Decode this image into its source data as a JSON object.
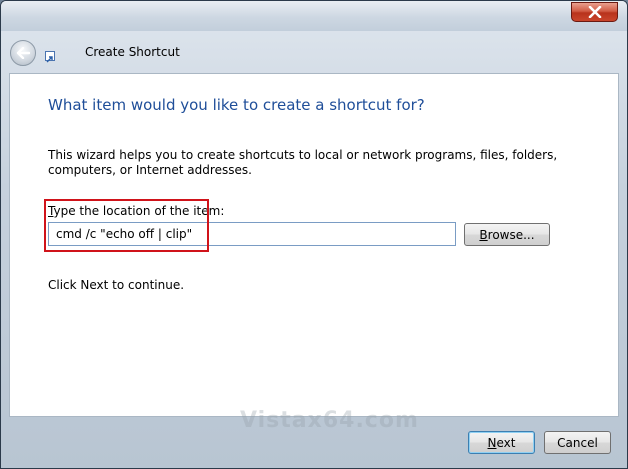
{
  "window": {
    "close_icon": "close-icon"
  },
  "nav": {
    "back_icon": "back-arrow-icon",
    "app_icon": "shortcut-icon",
    "title": "Create Shortcut"
  },
  "main": {
    "heading": "What item would you like to create a shortcut for?",
    "description": "This wizard helps you to create shortcuts to local or network programs, files, folders, computers, or Internet addresses.",
    "field_label_accel": "T",
    "field_label_rest": "ype the location of the item:",
    "location_value": "cmd /c \"echo off | clip\"",
    "browse_accel": "B",
    "browse_rest": "rowse...",
    "continue_text": "Click Next to continue.",
    "watermark": "Vistax64.com"
  },
  "footer": {
    "next_accel": "N",
    "next_rest": "ext",
    "cancel_label": "Cancel"
  },
  "colors": {
    "heading": "#1f4e99",
    "highlight": "#d0131a",
    "close": "#c9452c"
  }
}
